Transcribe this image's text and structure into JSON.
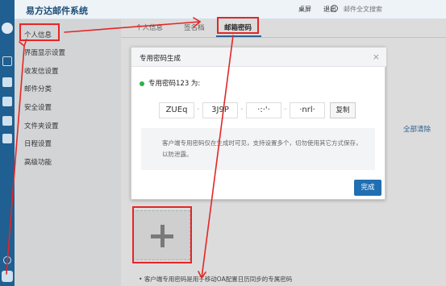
{
  "header": {
    "app_title": "易方达邮件系统",
    "link_desktop": "桌屏",
    "link_logout": "退出",
    "search_placeholder": "邮件全文搜索"
  },
  "sidebar": {
    "items": [
      {
        "label": "个人信息"
      },
      {
        "label": "界面显示设置"
      },
      {
        "label": "收发信设置"
      },
      {
        "label": "邮件分类"
      },
      {
        "label": "安全设置"
      },
      {
        "label": "文件夹设置"
      },
      {
        "label": "日程设置"
      },
      {
        "label": "高级功能"
      }
    ]
  },
  "main": {
    "tabs": [
      {
        "label": "个人信息"
      },
      {
        "label": "签名档"
      },
      {
        "label": "邮箱密码"
      }
    ],
    "clear_all": "全部清除",
    "tip": "客户端专用密码是用于移动OA配置日历同步的专属密码"
  },
  "dialog": {
    "title": "专用密码生成",
    "close": "×",
    "password_label": "专用密码123 为:",
    "codes": [
      "ZUEq",
      "3J9P",
      "·:·'·",
      "·nrl·"
    ],
    "copy_label": "复制",
    "note": "客户端专用密码仅在生成时可见，支持设置多个，切勿使用其它方式保存，以防泄露。",
    "done_label": "完成"
  },
  "colors": {
    "rail": "#1f5f91",
    "accent": "#1f6fb2",
    "annotation": "#e32626",
    "status_dot": "#2bb24c"
  }
}
